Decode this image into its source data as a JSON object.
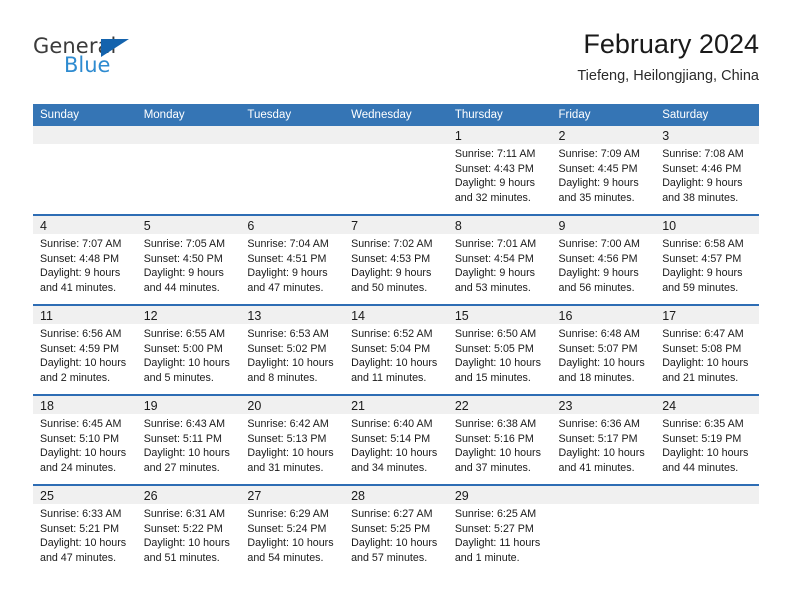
{
  "logo": {
    "word_one": "General",
    "word_two": "Blue",
    "triangle_icon": "triangle-icon",
    "brand_dark": "#3b3b3b",
    "brand_blue": "#2e8bd0",
    "triangle_blue": "#1463ad"
  },
  "header": {
    "title": "February 2024",
    "subtitle": "Tiefeng, Heilongjiang, China"
  },
  "theme": {
    "header_blue": "#3575b5",
    "row_divider_blue": "#2e6db4",
    "daynum_band_gray": "#f0f0f0",
    "text": "#1a1a1a"
  },
  "weekday_headers": [
    "Sunday",
    "Monday",
    "Tuesday",
    "Wednesday",
    "Thursday",
    "Friday",
    "Saturday"
  ],
  "weeks": [
    [
      {
        "day": "",
        "lines": []
      },
      {
        "day": "",
        "lines": []
      },
      {
        "day": "",
        "lines": []
      },
      {
        "day": "",
        "lines": []
      },
      {
        "day": "1",
        "lines": [
          "Sunrise: 7:11 AM",
          "Sunset: 4:43 PM",
          "Daylight: 9 hours",
          "and 32 minutes."
        ]
      },
      {
        "day": "2",
        "lines": [
          "Sunrise: 7:09 AM",
          "Sunset: 4:45 PM",
          "Daylight: 9 hours",
          "and 35 minutes."
        ]
      },
      {
        "day": "3",
        "lines": [
          "Sunrise: 7:08 AM",
          "Sunset: 4:46 PM",
          "Daylight: 9 hours",
          "and 38 minutes."
        ]
      }
    ],
    [
      {
        "day": "4",
        "lines": [
          "Sunrise: 7:07 AM",
          "Sunset: 4:48 PM",
          "Daylight: 9 hours",
          "and 41 minutes."
        ]
      },
      {
        "day": "5",
        "lines": [
          "Sunrise: 7:05 AM",
          "Sunset: 4:50 PM",
          "Daylight: 9 hours",
          "and 44 minutes."
        ]
      },
      {
        "day": "6",
        "lines": [
          "Sunrise: 7:04 AM",
          "Sunset: 4:51 PM",
          "Daylight: 9 hours",
          "and 47 minutes."
        ]
      },
      {
        "day": "7",
        "lines": [
          "Sunrise: 7:02 AM",
          "Sunset: 4:53 PM",
          "Daylight: 9 hours",
          "and 50 minutes."
        ]
      },
      {
        "day": "8",
        "lines": [
          "Sunrise: 7:01 AM",
          "Sunset: 4:54 PM",
          "Daylight: 9 hours",
          "and 53 minutes."
        ]
      },
      {
        "day": "9",
        "lines": [
          "Sunrise: 7:00 AM",
          "Sunset: 4:56 PM",
          "Daylight: 9 hours",
          "and 56 minutes."
        ]
      },
      {
        "day": "10",
        "lines": [
          "Sunrise: 6:58 AM",
          "Sunset: 4:57 PM",
          "Daylight: 9 hours",
          "and 59 minutes."
        ]
      }
    ],
    [
      {
        "day": "11",
        "lines": [
          "Sunrise: 6:56 AM",
          "Sunset: 4:59 PM",
          "Daylight: 10 hours",
          "and 2 minutes."
        ]
      },
      {
        "day": "12",
        "lines": [
          "Sunrise: 6:55 AM",
          "Sunset: 5:00 PM",
          "Daylight: 10 hours",
          "and 5 minutes."
        ]
      },
      {
        "day": "13",
        "lines": [
          "Sunrise: 6:53 AM",
          "Sunset: 5:02 PM",
          "Daylight: 10 hours",
          "and 8 minutes."
        ]
      },
      {
        "day": "14",
        "lines": [
          "Sunrise: 6:52 AM",
          "Sunset: 5:04 PM",
          "Daylight: 10 hours",
          "and 11 minutes."
        ]
      },
      {
        "day": "15",
        "lines": [
          "Sunrise: 6:50 AM",
          "Sunset: 5:05 PM",
          "Daylight: 10 hours",
          "and 15 minutes."
        ]
      },
      {
        "day": "16",
        "lines": [
          "Sunrise: 6:48 AM",
          "Sunset: 5:07 PM",
          "Daylight: 10 hours",
          "and 18 minutes."
        ]
      },
      {
        "day": "17",
        "lines": [
          "Sunrise: 6:47 AM",
          "Sunset: 5:08 PM",
          "Daylight: 10 hours",
          "and 21 minutes."
        ]
      }
    ],
    [
      {
        "day": "18",
        "lines": [
          "Sunrise: 6:45 AM",
          "Sunset: 5:10 PM",
          "Daylight: 10 hours",
          "and 24 minutes."
        ]
      },
      {
        "day": "19",
        "lines": [
          "Sunrise: 6:43 AM",
          "Sunset: 5:11 PM",
          "Daylight: 10 hours",
          "and 27 minutes."
        ]
      },
      {
        "day": "20",
        "lines": [
          "Sunrise: 6:42 AM",
          "Sunset: 5:13 PM",
          "Daylight: 10 hours",
          "and 31 minutes."
        ]
      },
      {
        "day": "21",
        "lines": [
          "Sunrise: 6:40 AM",
          "Sunset: 5:14 PM",
          "Daylight: 10 hours",
          "and 34 minutes."
        ]
      },
      {
        "day": "22",
        "lines": [
          "Sunrise: 6:38 AM",
          "Sunset: 5:16 PM",
          "Daylight: 10 hours",
          "and 37 minutes."
        ]
      },
      {
        "day": "23",
        "lines": [
          "Sunrise: 6:36 AM",
          "Sunset: 5:17 PM",
          "Daylight: 10 hours",
          "and 41 minutes."
        ]
      },
      {
        "day": "24",
        "lines": [
          "Sunrise: 6:35 AM",
          "Sunset: 5:19 PM",
          "Daylight: 10 hours",
          "and 44 minutes."
        ]
      }
    ],
    [
      {
        "day": "25",
        "lines": [
          "Sunrise: 6:33 AM",
          "Sunset: 5:21 PM",
          "Daylight: 10 hours",
          "and 47 minutes."
        ]
      },
      {
        "day": "26",
        "lines": [
          "Sunrise: 6:31 AM",
          "Sunset: 5:22 PM",
          "Daylight: 10 hours",
          "and 51 minutes."
        ]
      },
      {
        "day": "27",
        "lines": [
          "Sunrise: 6:29 AM",
          "Sunset: 5:24 PM",
          "Daylight: 10 hours",
          "and 54 minutes."
        ]
      },
      {
        "day": "28",
        "lines": [
          "Sunrise: 6:27 AM",
          "Sunset: 5:25 PM",
          "Daylight: 10 hours",
          "and 57 minutes."
        ]
      },
      {
        "day": "29",
        "lines": [
          "Sunrise: 6:25 AM",
          "Sunset: 5:27 PM",
          "Daylight: 11 hours",
          "and 1 minute."
        ]
      },
      {
        "day": "",
        "lines": []
      },
      {
        "day": "",
        "lines": []
      }
    ]
  ]
}
